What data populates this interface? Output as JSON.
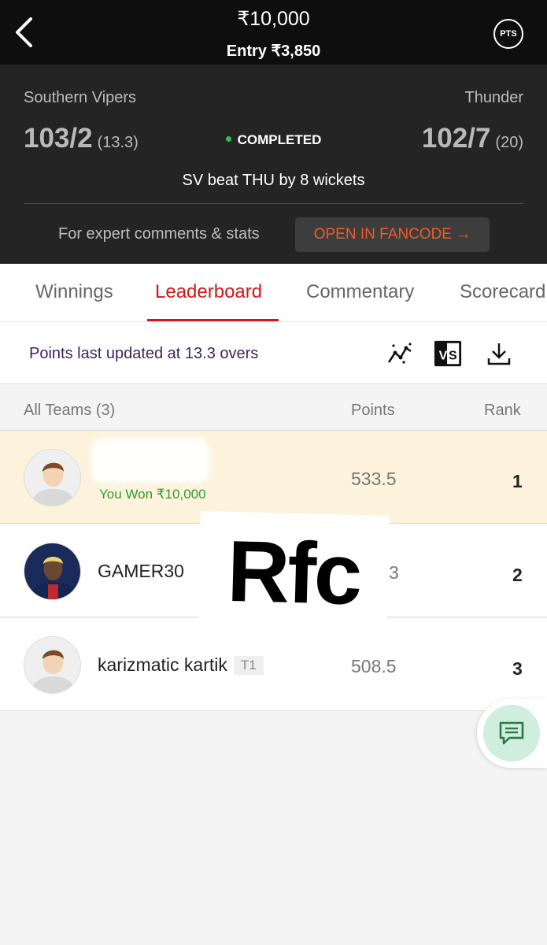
{
  "header": {
    "prize": "₹10,000",
    "entry": "Entry ₹3,850",
    "pts_label": "PTS"
  },
  "match": {
    "team_left": {
      "name": "Southern Vipers",
      "score": "103/2",
      "overs": "(13.3)"
    },
    "team_right": {
      "name": "Thunder",
      "score": "102/7",
      "overs": "(20)"
    },
    "status": "COMPLETED",
    "result": "SV beat THU by 8 wickets",
    "expert_text": "For expert comments & stats",
    "fancode_button": "OPEN IN FANCODE →"
  },
  "tabs": [
    {
      "label": "Winnings"
    },
    {
      "label": "Leaderboard"
    },
    {
      "label": "Commentary"
    },
    {
      "label": "Scorecard"
    }
  ],
  "leaderboard": {
    "updated_text": "Points last updated at 13.3 overs",
    "headers": {
      "teams": "All Teams (3)",
      "points": "Points",
      "rank": "Rank"
    },
    "rows": [
      {
        "name": "",
        "won": "You Won ₹10,000",
        "points": "533.5",
        "rank": "1"
      },
      {
        "name": "GAMER30",
        "points": "3",
        "rank": "2"
      },
      {
        "name": "karizmatic kartik",
        "tag": "T1",
        "points": "508.5",
        "rank": "3"
      }
    ]
  },
  "overlay": {
    "text": "Rfc"
  },
  "colors": {
    "accent": "#d0181a",
    "fancode": "#f05a28",
    "win": "#2a9d2e",
    "highlight_row": "#fdf3dd"
  }
}
